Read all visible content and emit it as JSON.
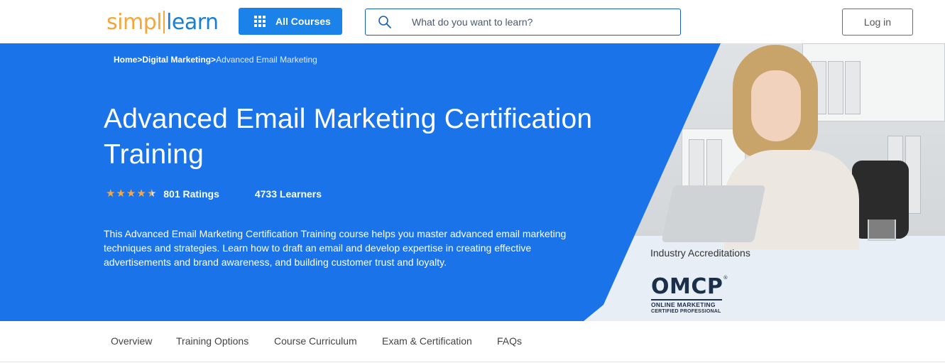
{
  "header": {
    "logo_part1": "simpl",
    "logo_part2": "learn",
    "all_courses_label": "All Courses",
    "search_placeholder": "What do you want to learn?",
    "login_label": "Log in"
  },
  "breadcrumb": {
    "home": "Home",
    "sep1": ">",
    "category": "Digital Marketing",
    "sep2": ">",
    "current": "Advanced Email Marketing"
  },
  "course": {
    "title": "Advanced Email Marketing Certification Training",
    "rating_stars": 4.5,
    "ratings_text": "801 Ratings",
    "learners_text": "4733 Learners",
    "description": "This Advanced Email Marketing Certification Training course helps you master advanced email marketing techniques and strategies. Learn how to draft an email and develop expertise in creating effective advertisements and brand awareness, and building customer trust and loyalty."
  },
  "accreditation": {
    "label": "Industry Accreditations",
    "logo_main": "OMCP",
    "logo_mark": "®",
    "logo_line1": "ONLINE MARKETING",
    "logo_line2": "CERTIFIED PROFESSIONAL"
  },
  "tabs": [
    "Overview",
    "Training Options",
    "Course Curriculum",
    "Exam & Certification",
    "FAQs"
  ],
  "colors": {
    "brand_blue": "#1a73e8",
    "button_blue": "#1a82e8",
    "star_orange": "#f0a94a",
    "logo_orange": "#f3a63a",
    "accreditation_bg": "#e8eef5"
  },
  "icons": {
    "menu": "grid-icon",
    "search": "search-icon",
    "star": "star-icon"
  }
}
